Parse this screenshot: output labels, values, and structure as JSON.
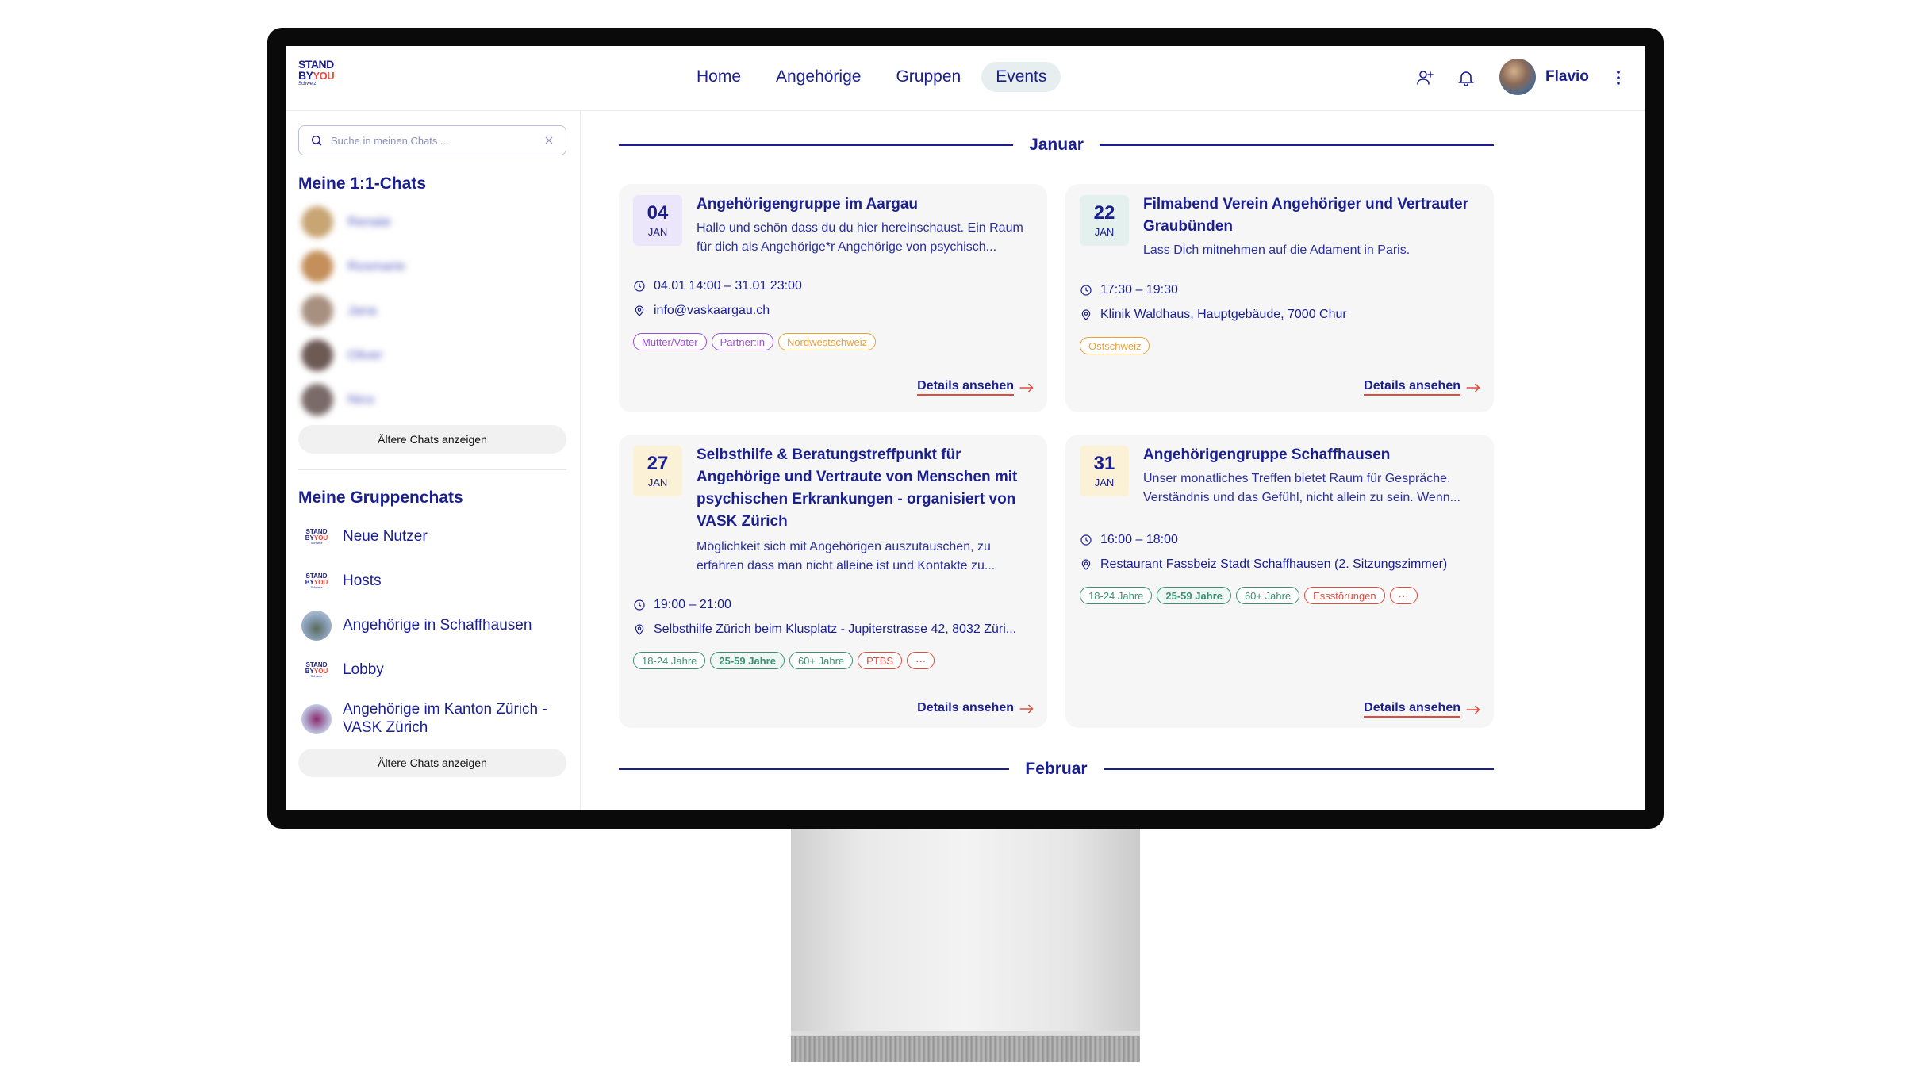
{
  "header": {
    "logo": {
      "line1": "STAND",
      "line2a": "BY",
      "line2b": "YOU",
      "line3": "Schweiz"
    },
    "nav": [
      {
        "label": "Home"
      },
      {
        "label": "Angehörige"
      },
      {
        "label": "Gruppen"
      },
      {
        "label": "Events",
        "active": true
      }
    ],
    "user_name": "Flavio",
    "icons": [
      "add-user-icon",
      "bell-icon",
      "more-vertical-icon"
    ]
  },
  "sidebar": {
    "search_placeholder": "Suche in meinen Chats ...",
    "direct_title": "Meine 1:1-Chats",
    "direct_chats": [
      {
        "name": "Renate"
      },
      {
        "name": "Rosmarie"
      },
      {
        "name": "Jana"
      },
      {
        "name": "Oliver"
      },
      {
        "name": "Nico"
      }
    ],
    "older_label": "Ältere Chats anzeigen",
    "groups_title": "Meine Gruppenchats",
    "groups": [
      {
        "name": "Neue Nutzer"
      },
      {
        "name": "Hosts"
      },
      {
        "name": "Angehörige in Schaffhausen"
      },
      {
        "name": "Lobby"
      },
      {
        "name": "Angehörige im Kanton Zürich - VASK Zürich"
      }
    ],
    "older_groups_label": "Ältere Chats anzeigen"
  },
  "main": {
    "months": [
      {
        "label": "Januar"
      },
      {
        "label": "Februar"
      }
    ],
    "details_label": "Details ansehen",
    "events": [
      {
        "day": "04",
        "month": "JAN",
        "title": "Angehörigengruppe im Aargau",
        "desc": "Hallo und schön dass du du hier hereinschaust. Ein Raum für dich als Angehörige*r Angehörige von psychisch...",
        "time": "04.01 14:00 – 31.01 23:00",
        "location": "info@vaskaargau.ch",
        "tags": [
          "Mutter/Vater",
          "Partner:in",
          "Nordwestschweiz"
        ]
      },
      {
        "day": "22",
        "month": "JAN",
        "title": "Filmabend Verein Angehöriger und Vertrauter Graubünden",
        "desc": "Lass Dich mitnehmen auf die Adament in Paris.",
        "time": "17:30 – 19:30",
        "location": "Klinik Waldhaus, Hauptgebäude, 7000 Chur",
        "tags": [
          "Ostschweiz"
        ]
      },
      {
        "day": "27",
        "month": "JAN",
        "title": "Selbsthilfe & Beratungstreffpunkt für Angehörige und Vertraute von Menschen mit psychischen Erkrankungen - organisiert von VASK Zürich",
        "desc": "Möglichkeit sich mit Angehörigen auszutauschen, zu erfahren dass man nicht alleine ist und Kontakte zu...",
        "time": "19:00 – 21:00",
        "location": "Selbsthilfe Zürich beim Klusplatz - Jupiterstrasse 42, 8032 Züri...",
        "tags": [
          "18-24 Jahre",
          "25-59 Jahre",
          "60+ Jahre",
          "PTBS",
          "···"
        ]
      },
      {
        "day": "31",
        "month": "JAN",
        "title": "Angehörigengruppe Schaffhausen",
        "desc": " Unser monatliches Treffen bietet Raum für Gespräche. Verständnis und das Gefühl, nicht allein zu sein.  Wenn...",
        "time": "16:00 – 18:00",
        "location": "Restaurant Fassbeiz Stadt Schaffhausen (2. Sitzungszimmer)",
        "tags": [
          "18-24 Jahre",
          "25-59 Jahre",
          "60+ Jahre",
          "Essstörungen",
          "···"
        ]
      }
    ]
  },
  "colors": {
    "brand_blue": "#1a1f8f",
    "brand_red": "#ea4a3c",
    "purple_date": "#ece6fb",
    "teal_date": "#e3f0ee",
    "yellow_date": "#fbf1d6"
  }
}
